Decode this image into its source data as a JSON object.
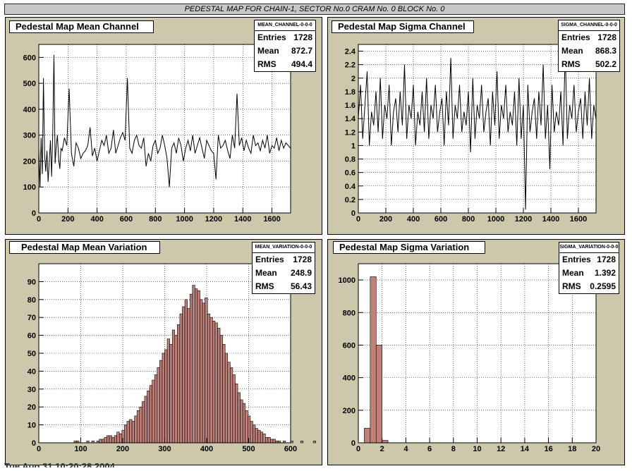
{
  "canvas_title": "PEDESTAL MAP FOR CHAIN-1, SECTOR No.0 CRAM No. 0 BLOCK No. 0",
  "date_text": "Tue Aug 31 10:20:28 2004",
  "colors": {
    "pad_bg": "#cdc7ac",
    "hist_fill": "#c0807a",
    "line": "#000000"
  },
  "chart_data": [
    {
      "type": "line",
      "title": "Pedestal Map Mean Channel",
      "stats": {
        "name": "MEAN_CHANNEL-0-0-0",
        "entries_label": "Entries",
        "entries": "1728",
        "mean_label": "Mean",
        "mean": "872.7",
        "rms_label": "RMS",
        "rms": "494.4"
      },
      "xlim": [
        0,
        1728
      ],
      "ylim": [
        0,
        650
      ],
      "xticks": [
        0,
        200,
        400,
        600,
        800,
        1000,
        1200,
        1400,
        1600
      ],
      "yticks": [
        0,
        100,
        200,
        300,
        400,
        500,
        600
      ],
      "grid": true,
      "series": [
        {
          "x": [
            0,
            8,
            16,
            24,
            32,
            40,
            48,
            56,
            64,
            72,
            80,
            88,
            96,
            104,
            112,
            120,
            128,
            136,
            144,
            152,
            160,
            176,
            192,
            208,
            224,
            240,
            256,
            272,
            288,
            304,
            320,
            336,
            352,
            368,
            384,
            400,
            416,
            432,
            448,
            464,
            480,
            496,
            512,
            528,
            544,
            560,
            576,
            592,
            608,
            624,
            640,
            656,
            672,
            688,
            704,
            720,
            736,
            752,
            768,
            784,
            800,
            816,
            832,
            848,
            864,
            880,
            896,
            912,
            928,
            944,
            960,
            976,
            992,
            1008,
            1024,
            1040,
            1056,
            1072,
            1088,
            1104,
            1120,
            1136,
            1152,
            1168,
            1184,
            1200,
            1216,
            1232,
            1248,
            1264,
            1280,
            1296,
            1312,
            1328,
            1344,
            1360,
            1376,
            1392,
            1408,
            1424,
            1440,
            1456,
            1472,
            1488,
            1504,
            1520,
            1536,
            1552,
            1568,
            1584,
            1600,
            1616,
            1632,
            1648,
            1664,
            1680,
            1696,
            1712,
            1727
          ],
          "y": [
            250,
            100,
            290,
            150,
            520,
            220,
            160,
            240,
            120,
            200,
            280,
            140,
            310,
            610,
            190,
            260,
            300,
            210,
            170,
            250,
            240,
            290,
            260,
            480,
            230,
            180,
            270,
            250,
            210,
            230,
            240,
            260,
            330,
            220,
            250,
            200,
            240,
            280,
            260,
            300,
            230,
            250,
            320,
            230,
            260,
            290,
            310,
            280,
            520,
            250,
            230,
            280,
            300,
            260,
            250,
            290,
            180,
            230,
            200,
            260,
            280,
            230,
            250,
            300,
            260,
            210,
            100,
            250,
            270,
            230,
            290,
            260,
            200,
            250,
            280,
            240,
            300,
            230,
            260,
            290,
            250,
            210,
            280,
            260,
            240,
            230,
            130,
            300,
            250,
            260,
            280,
            240,
            210,
            300,
            250,
            460,
            260,
            290,
            240,
            280,
            250,
            230,
            300,
            260,
            270,
            240,
            280,
            250,
            300,
            230,
            260,
            250,
            290,
            240,
            280,
            250,
            270,
            260,
            250
          ]
        }
      ]
    },
    {
      "type": "line",
      "title": "Pedestal Map Sigma Channel",
      "stats": {
        "name": "SIGMA_CHANNEL-0-0-0",
        "entries_label": "Entries",
        "entries": "1728",
        "mean_label": "Mean",
        "mean": "868.3",
        "rms_label": "RMS",
        "rms": "502.2"
      },
      "xlim": [
        0,
        1728
      ],
      "ylim": [
        0,
        2.5
      ],
      "xticks": [
        0,
        200,
        400,
        600,
        800,
        1000,
        1200,
        1400,
        1600
      ],
      "yticks": [
        0,
        0.2,
        0.4,
        0.6,
        0.8,
        1,
        1.2,
        1.4,
        1.6,
        1.8,
        2,
        2.2,
        2.4
      ],
      "grid": true,
      "series": [
        {
          "x": [
            0,
            16,
            32,
            48,
            64,
            80,
            96,
            112,
            128,
            144,
            160,
            176,
            192,
            208,
            224,
            240,
            256,
            272,
            288,
            304,
            320,
            336,
            352,
            368,
            384,
            400,
            416,
            432,
            448,
            464,
            480,
            496,
            512,
            528,
            544,
            560,
            576,
            592,
            608,
            624,
            640,
            656,
            672,
            688,
            704,
            720,
            736,
            752,
            768,
            784,
            800,
            816,
            832,
            848,
            864,
            880,
            896,
            912,
            928,
            944,
            960,
            976,
            992,
            1008,
            1024,
            1040,
            1056,
            1072,
            1088,
            1104,
            1120,
            1136,
            1152,
            1168,
            1184,
            1200,
            1216,
            1232,
            1248,
            1264,
            1280,
            1296,
            1312,
            1328,
            1344,
            1360,
            1376,
            1392,
            1408,
            1424,
            1440,
            1456,
            1472,
            1488,
            1504,
            1520,
            1536,
            1552,
            1568,
            1584,
            1600,
            1616,
            1632,
            1648,
            1664,
            1680,
            1696,
            1712,
            1727
          ],
          "y": [
            1.4,
            1.9,
            1.1,
            1.6,
            2.1,
            1.0,
            1.5,
            1.3,
            1.8,
            1.2,
            2.0,
            1.1,
            1.6,
            1.4,
            1.9,
            1.0,
            1.5,
            1.7,
            1.2,
            1.8,
            1.3,
            2.2,
            1.1,
            1.6,
            1.4,
            1.9,
            1.0,
            1.5,
            1.3,
            1.8,
            1.2,
            2.0,
            1.1,
            1.6,
            1.4,
            1.9,
            1.2,
            1.5,
            1.7,
            1.0,
            1.8,
            1.3,
            2.3,
            1.1,
            1.6,
            1.4,
            1.9,
            1.2,
            1.5,
            1.3,
            1.8,
            0.9,
            2.0,
            1.1,
            1.6,
            1.4,
            1.9,
            1.2,
            1.5,
            1.7,
            1.0,
            1.8,
            1.3,
            2.1,
            1.1,
            1.6,
            1.4,
            1.9,
            1.2,
            1.5,
            1.3,
            1.8,
            1.0,
            2.0,
            1.1,
            1.6,
            0.05,
            1.9,
            1.2,
            1.5,
            1.7,
            1.1,
            1.8,
            1.3,
            2.2,
            1.1,
            1.6,
            0.65,
            1.9,
            1.2,
            1.5,
            1.3,
            1.8,
            1.0,
            2.4,
            1.1,
            1.6,
            1.4,
            1.9,
            1.2,
            1.5,
            1.7,
            1.1,
            1.8,
            1.3,
            2.0,
            1.1,
            1.6,
            1.4
          ]
        }
      ]
    },
    {
      "type": "bar",
      "title": "Pedestal Map Mean Variation",
      "stats": {
        "name": "MEAN_VARIATION-0-0-0",
        "entries_label": "Entries",
        "entries": "1728",
        "mean_label": "Mean",
        "mean": "248.9",
        "rms_label": "RMS",
        "rms": "56.43"
      },
      "xlim": [
        0,
        600
      ],
      "ylim": [
        0,
        100
      ],
      "xticks": [
        0,
        100,
        200,
        300,
        400,
        500,
        600
      ],
      "yticks": [
        0,
        10,
        20,
        30,
        40,
        50,
        60,
        70,
        80,
        90
      ],
      "grid": true,
      "bin_width": 6,
      "bins_start": 84,
      "values": [
        1,
        1,
        0,
        0,
        0,
        1,
        0,
        1,
        0,
        1,
        2,
        2,
        3,
        4,
        4,
        3,
        4,
        6,
        5,
        7,
        10,
        12,
        13,
        12,
        15,
        18,
        20,
        23,
        26,
        29,
        32,
        35,
        38,
        42,
        46,
        50,
        52,
        58,
        55,
        63,
        60,
        66,
        72,
        76,
        80,
        75,
        83,
        88,
        86,
        85,
        80,
        78,
        81,
        72,
        70,
        68,
        67,
        64,
        60,
        55,
        50,
        45,
        42,
        38,
        33,
        28,
        24,
        22,
        18,
        15,
        12,
        10,
        8,
        7,
        6,
        5,
        3,
        3,
        2,
        2,
        1,
        1,
        0,
        1,
        0,
        0,
        1,
        0,
        0,
        0,
        1,
        0,
        0,
        0,
        0,
        1,
        0,
        0,
        0,
        0,
        0,
        1,
        0,
        0,
        0,
        0,
        0,
        1,
        0,
        0,
        0,
        1,
        0,
        0,
        0,
        0,
        0,
        0,
        0,
        1,
        0,
        0,
        0,
        0,
        0,
        0,
        0,
        0,
        0,
        0,
        0,
        0,
        0,
        0,
        0,
        0,
        1,
        0,
        0,
        0,
        0,
        0,
        0,
        0,
        0,
        0,
        0,
        0,
        1
      ]
    },
    {
      "type": "bar",
      "title": "Pedestal Map Sigma Variation",
      "stats": {
        "name": "SIGMA_VARIATION-0-0-0",
        "entries_label": "Entries",
        "entries": "1728",
        "mean_label": "Mean",
        "mean": "1.392",
        "rms_label": "RMS",
        "rms": "0.2595"
      },
      "xlim": [
        0,
        20
      ],
      "ylim": [
        0,
        1100
      ],
      "xticks": [
        0,
        2,
        4,
        6,
        8,
        10,
        12,
        14,
        16,
        18,
        20
      ],
      "yticks": [
        0,
        200,
        400,
        600,
        800,
        1000
      ],
      "grid": true,
      "bin_width": 0.5,
      "bins_start": 0.5,
      "values": [
        90,
        1020,
        600,
        15
      ]
    }
  ]
}
